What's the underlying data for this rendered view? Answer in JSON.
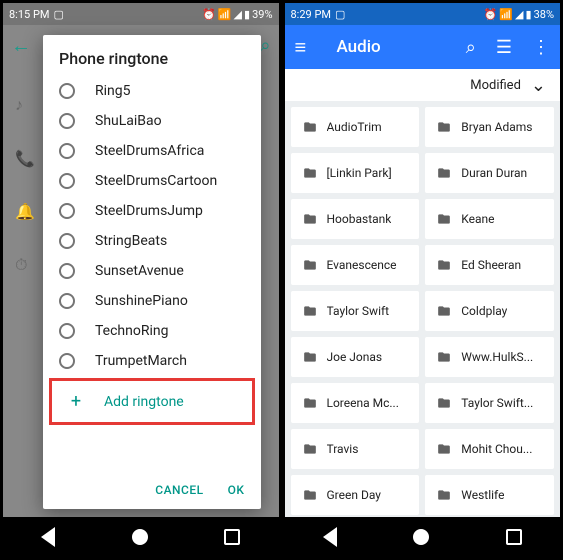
{
  "left": {
    "status": {
      "time": "8:15 PM",
      "battery": "39%"
    },
    "dialog": {
      "title": "Phone ringtone",
      "items": [
        "Ring5",
        "ShuLaiBao",
        "SteelDrumsAfrica",
        "SteelDrumsCartoon",
        "SteelDrumsJump",
        "StringBeats",
        "SunsetAvenue",
        "SunshinePiano",
        "TechnoRing",
        "TrumpetMarch"
      ],
      "add": "Add ringtone",
      "cancel": "CANCEL",
      "ok": "OK"
    }
  },
  "right": {
    "status": {
      "time": "8:29 PM",
      "battery": "38%"
    },
    "appbar": {
      "title": "Audio"
    },
    "sort": {
      "label": "Modified"
    },
    "folders": [
      "AudioTrim",
      "Bryan Adams",
      "[Linkin Park]",
      "Duran Duran",
      "Hoobastank",
      "Keane",
      "Evanescence",
      "Ed Sheeran",
      "Taylor Swift",
      "Coldplay",
      "Joe Jonas",
      "Www.HulkS...",
      "Loreena Mc...",
      "Taylor Swift...",
      "Travis",
      "Mohit Chou...",
      "Green Day",
      "Westlife"
    ]
  }
}
